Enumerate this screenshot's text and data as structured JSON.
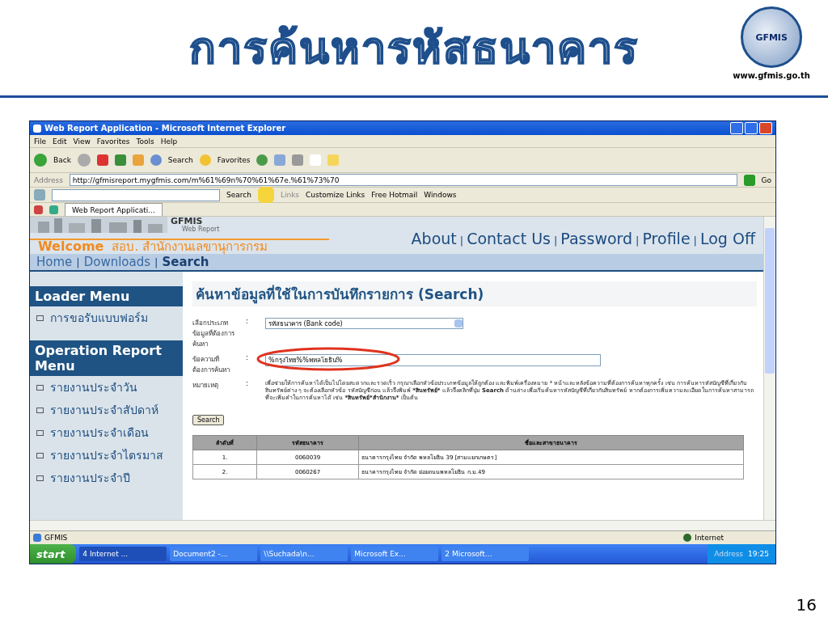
{
  "slide": {
    "title": "การค้นหารหัสธนาคาร",
    "logo_text": "GFMIS",
    "website": "www.gfmis.go.th",
    "page_number": "16"
  },
  "window": {
    "title": "Web Report Application - Microsoft Internet Explorer"
  },
  "menu": [
    "File",
    "Edit",
    "View",
    "Favorites",
    "Tools",
    "Help"
  ],
  "toolbar": {
    "back": "Back",
    "search": "Search",
    "favorites": "Favorites"
  },
  "address": {
    "label": "Address",
    "url": "http://gfmisreport.mygfmis.com/m%61%69n%70%61%67e.%61%73%70",
    "go": "Go"
  },
  "links_bar": {
    "search": "Search",
    "links": "Links",
    "items": [
      "Customize Links",
      "Free Hotmail",
      "Windows"
    ]
  },
  "tabs": [
    {
      "label": "Web Report Applicati...",
      "selected": true
    }
  ],
  "site": {
    "brand": "GFMIS",
    "brand_sub": "Web Report",
    "separator": "|",
    "top_nav": [
      "About",
      "Contact Us",
      "Password",
      "Profile",
      "Log Off"
    ],
    "welcome": "Welcome",
    "org": "สอบ. สำนักงานเลขานุการกรม",
    "breadcrumb": [
      {
        "label": "Home",
        "selected": false
      },
      {
        "label": "Downloads",
        "selected": false
      },
      {
        "label": "Search",
        "selected": true
      }
    ]
  },
  "sidebar": [
    {
      "title": "Loader Menu",
      "items": [
        "การขอรับแบบฟอร์ม"
      ]
    },
    {
      "title": "Operation Report Menu",
      "items": [
        "รายงานประจำวัน",
        "รายงานประจำสัปดาห์",
        "รายงานประจำเดือน",
        "รายงานประจำไตรมาส",
        "รายงานประจำปี"
      ]
    }
  ],
  "search_form": {
    "heading": "ค้นหาข้อมูลที่ใช้ในการบันทึกรายการ (Search)",
    "fields": [
      {
        "kind": "select",
        "label": "เลือกประเภทข้อมูลที่ต้องการค้นหา",
        "colon": ":",
        "value": "รหัสธนาคาร (Bank code)",
        "highlighted": false
      },
      {
        "kind": "text",
        "label": "ข้อความที่ต้องการค้นหา",
        "colon": ":",
        "value": "%กรุงไทย%%พหลโยธิน%",
        "highlighted": true
      }
    ],
    "note_label": "หมายเหตุ",
    "note_colon": ":",
    "note": [
      {
        "text": "เพื่อช่วยให้การค้นหาได้เป็นไปโดยสะดวกและรวดเร็ว กรุณาเลือกหัวข้อประเภทข้อมูลให้ถูกต้อง และพิมพ์เครื่องหมาย * หน้าและหลังข้อความที่ต้องการค้นหาทุกครั้ง เช่น การค้นหารหัสบัญชีที่เกี่ยวกับสินทรัพย์ต่าง ๆ จะต้องเลือกหัวข้อ รหัสบัญชีก่อน แล้วจึงพิมพ์ ",
        "bold": false
      },
      {
        "text": "*สินทรัพย์*",
        "bold": true
      },
      {
        "text": " แล้วจึงคลิกที่ปุ่ม ",
        "bold": false
      },
      {
        "text": "Search",
        "bold": true
      },
      {
        "text": " ด้านล่าง เพื่อเริ่มค้นหารหัสบัญชีที่เกี่ยวกับสินทรัพย์ หากต้องการเพิ่มความละเอียดในการค้นหาสามารถที่จะเพิ่มคำในการค้นหาได้ เช่น ",
        "bold": false
      },
      {
        "text": "*สินทรัพย์*สำนักงาน*",
        "bold": true
      },
      {
        "text": " เป็นต้น",
        "bold": false
      }
    ],
    "button": "Search"
  },
  "results": {
    "columns": [
      "ลำดับที่",
      "รหัสธนาคาร",
      "ชื่อและสาขาธนาคาร"
    ],
    "rows": [
      [
        "1.",
        "0060039",
        "ธนาคารกรุงไทย จำกัด พหลโยธิน 39 [สามแยกเกษตร]"
      ],
      [
        "2.",
        "0060267",
        "ธนาคารกรุงไทย จำกัด ย่อยถนนพหลโยธิน ก.ม.49"
      ]
    ]
  },
  "status_bar": {
    "text": "GFMIS",
    "zone": "Internet"
  },
  "taskbar": {
    "start": "start",
    "items": [
      {
        "label": "4 Internet ...",
        "selected": true
      },
      {
        "label": "Document2 -...",
        "selected": false
      },
      {
        "label": "\\\\Suchada\\n...",
        "selected": false
      },
      {
        "label": "Microsoft Ex...",
        "selected": false
      },
      {
        "label": "2 Microsoft...",
        "selected": false
      }
    ],
    "address": "Address",
    "clock": "19:25"
  }
}
